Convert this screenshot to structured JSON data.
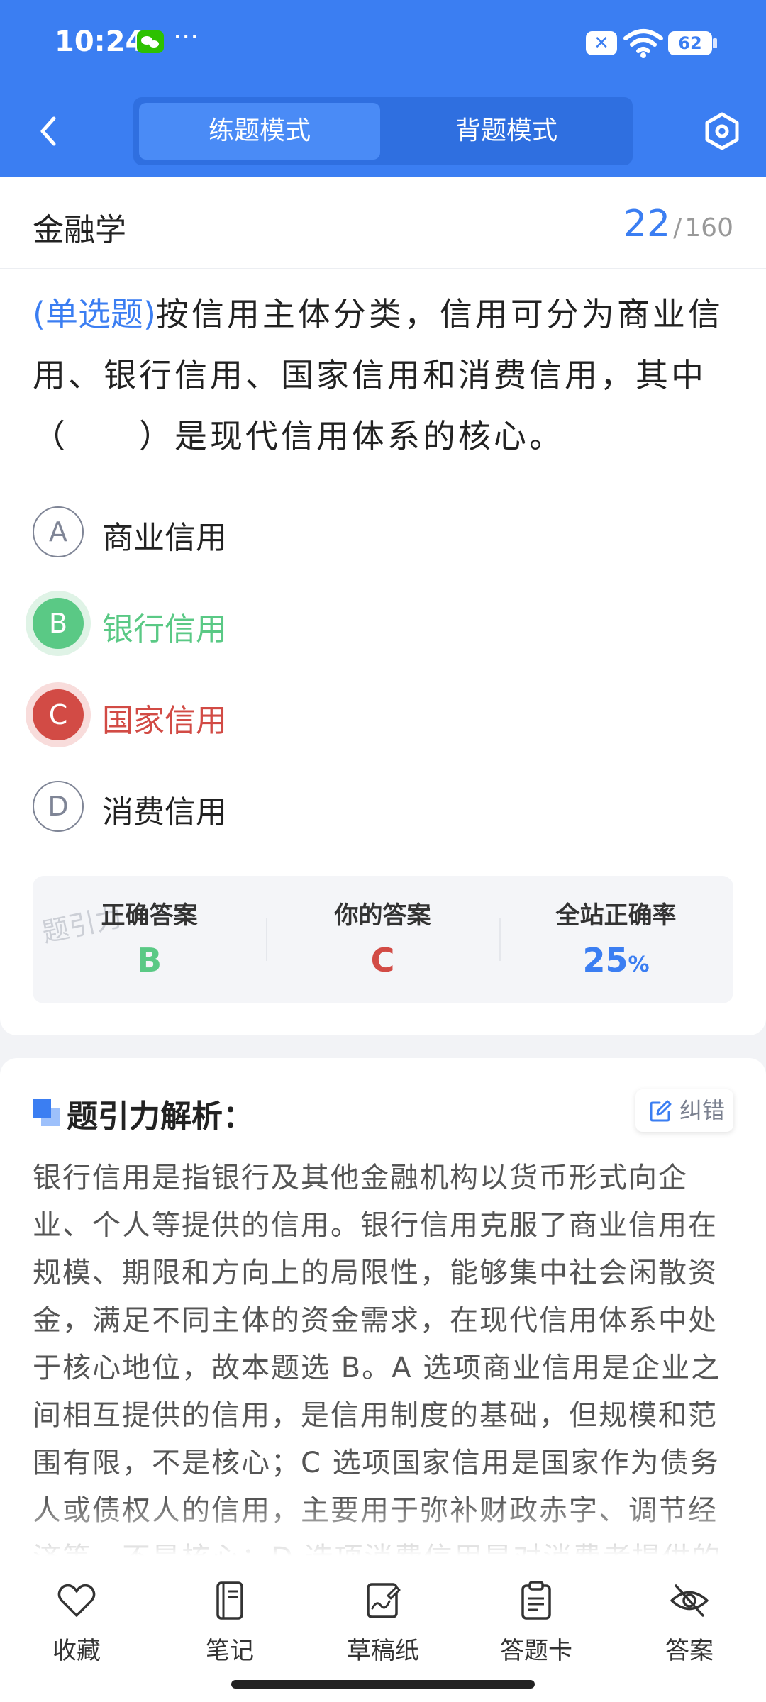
{
  "status": {
    "time": "10:24",
    "battery": "62"
  },
  "nav": {
    "modes": [
      "练题模式",
      "背题模式"
    ],
    "active_mode": 0
  },
  "subject": {
    "name": "金融学",
    "current": "22",
    "total": "160"
  },
  "question": {
    "type_tag": "(单选题)",
    "text": "按信用主体分类，信用可分为商业信用、银行信用、国家信用和消费信用，其中（　　）是现代信用体系的核心。",
    "options": [
      {
        "letter": "A",
        "text": "商业信用",
        "state": "normal"
      },
      {
        "letter": "B",
        "text": "银行信用",
        "state": "correct"
      },
      {
        "letter": "C",
        "text": "国家信用",
        "state": "wrong"
      },
      {
        "letter": "D",
        "text": "消费信用",
        "state": "normal"
      }
    ]
  },
  "result": {
    "watermark": "题引力",
    "correct_label": "正确答案",
    "correct_value": "B",
    "yours_label": "你的答案",
    "yours_value": "C",
    "rate_label": "全站正确率",
    "rate_value": "25",
    "rate_unit": "%"
  },
  "analysis": {
    "title": "题引力解析：",
    "report_label": "纠错",
    "body": "银行信用是指银行及其他金融机构以货币形式向企业、个人等提供的信用。银行信用克服了商业信用在规模、期限和方向上的局限性，能够集中社会闲散资金，满足不同主体的资金需求，在现代信用体系中处于核心地位，故本题选 B。A 选项商业信用是企业之间相互提供的信用，是信用制度的基础，但规模和范围有限，不是核心；C 选项国家信用是国家作为债务人或债权人的信用，主要用于弥补财政赤字、调节经济等，不是核心；D 选项消费信用是对消费者提供的"
  },
  "tabs": [
    {
      "label": "收藏",
      "icon": "heart-icon"
    },
    {
      "label": "笔记",
      "icon": "notebook-icon"
    },
    {
      "label": "草稿纸",
      "icon": "draft-icon"
    },
    {
      "label": "答题卡",
      "icon": "clipboard-icon"
    },
    {
      "label": "答案",
      "icon": "eye-off-icon"
    }
  ],
  "colors": {
    "brand": "#3b7ef2",
    "correct": "#5ac985",
    "wrong": "#d24b45"
  }
}
